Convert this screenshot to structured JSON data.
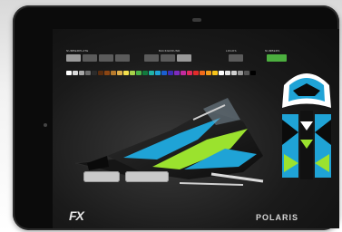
{
  "ui": {
    "groups": [
      {
        "label": "NUMBERPLATE"
      },
      {
        "label": "BACKGROUND"
      },
      {
        "label": "LOGOS"
      },
      {
        "label": "NUMBERS"
      }
    ],
    "number_plate_buttons": [
      "",
      "",
      "",
      ""
    ],
    "background_buttons": [
      "",
      "",
      ""
    ],
    "logo_buttons": [
      ""
    ],
    "number_buttons": [
      ""
    ],
    "bottom_buttons": [
      "",
      ""
    ],
    "brand_left": "FX",
    "brand_right": "POLARIS"
  },
  "colors": {
    "accent_green": "#4caf3f",
    "graphics_blue": "#1fa3d6",
    "graphics_lime": "#9be22e",
    "swatches": [
      "#ffffff",
      "#d9d9d9",
      "#a8a8a8",
      "#6d6d6d",
      "#2b2b2b",
      "#5a2d0f",
      "#8b4513",
      "#b77a2c",
      "#e0b04b",
      "#f4e04d",
      "#a8d34a",
      "#49b448",
      "#127a3d",
      "#21b3a5",
      "#1fa3d6",
      "#1a5fd0",
      "#3d2db5",
      "#7d2bbf",
      "#c22b9f",
      "#e22b5f",
      "#e22b2b",
      "#f06a1b",
      "#f29c1b",
      "#f7c41b",
      "#ffffff",
      "#e6e6e6",
      "#cfcfcf",
      "#999999",
      "#555555",
      "#000000"
    ]
  }
}
